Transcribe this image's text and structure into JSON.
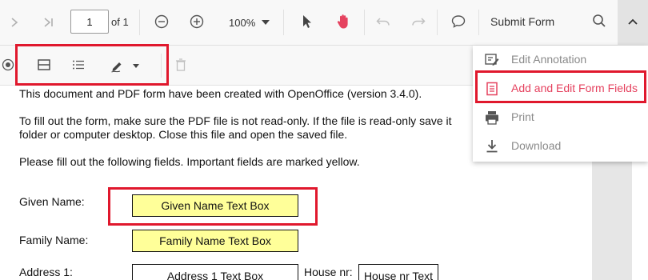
{
  "toolbar": {
    "page_current": "1",
    "page_total": "of 1",
    "zoom": "100%",
    "submit_label": "Submit Form"
  },
  "menu": {
    "items": [
      {
        "label": "Edit Annotation"
      },
      {
        "label": "Add and Edit Form Fields"
      },
      {
        "label": "Print"
      },
      {
        "label": "Download"
      }
    ]
  },
  "doc": {
    "line1": "This document and PDF form have been created with OpenOffice (version 3.4.0).",
    "line2": "To fill out the form, make sure the PDF file is not read-only. If the file is read-only save it",
    "line3": "folder or computer desktop. Close this file and open the saved file.",
    "line4": "Please fill out the following fields. Important fields are marked yellow.",
    "given_label": "Given Name:",
    "given_field": "Given Name Text Box",
    "family_label": "Family Name:",
    "family_field": "Family Name Text Box",
    "address_label": "Address 1:",
    "address_field": "Address 1 Text Box",
    "house_label": "House nr:",
    "house_field": "House nr Text"
  },
  "colors": {
    "highlight": "#e0182d",
    "required_field": "#ffff99",
    "active_menu": "#e5425f"
  }
}
